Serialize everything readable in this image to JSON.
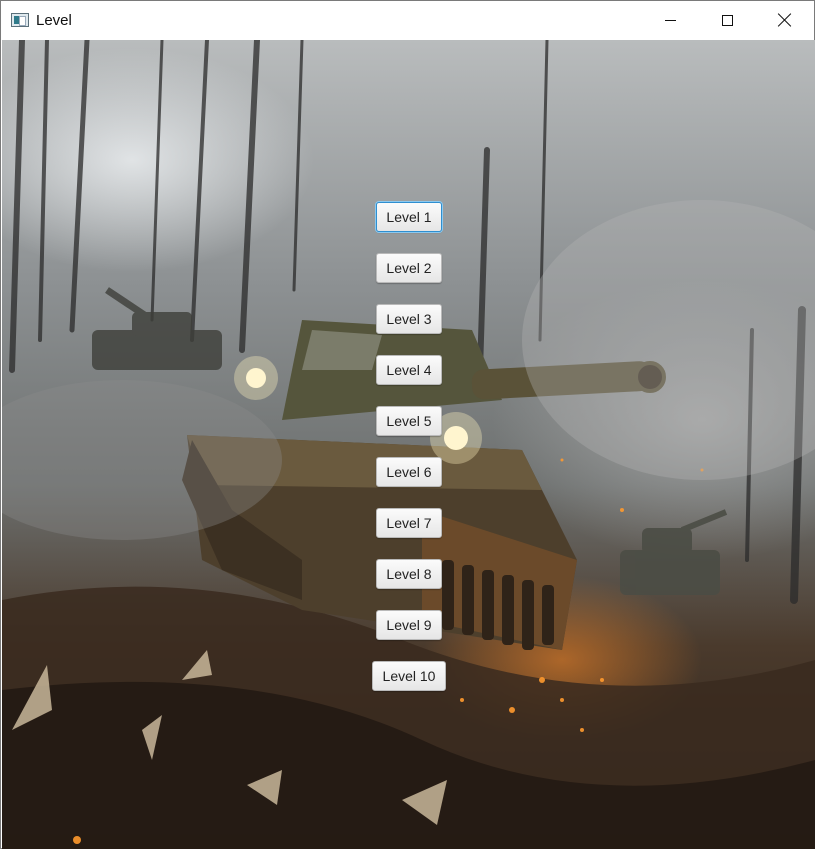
{
  "window": {
    "title": "Level",
    "icon": "app-window-icon"
  },
  "controls": {
    "minimize": "minimize-icon",
    "maximize": "maximize-icon",
    "close": "close-icon"
  },
  "background": {
    "accent_fire": "#ff8c28"
  },
  "levels": [
    {
      "label": "Level 1",
      "focused": true
    },
    {
      "label": "Level 2"
    },
    {
      "label": "Level 3"
    },
    {
      "label": "Level 4"
    },
    {
      "label": "Level 5"
    },
    {
      "label": "Level 6"
    },
    {
      "label": "Level 7"
    },
    {
      "label": "Level 8"
    },
    {
      "label": "Level 9"
    },
    {
      "label": "Level 10"
    }
  ]
}
